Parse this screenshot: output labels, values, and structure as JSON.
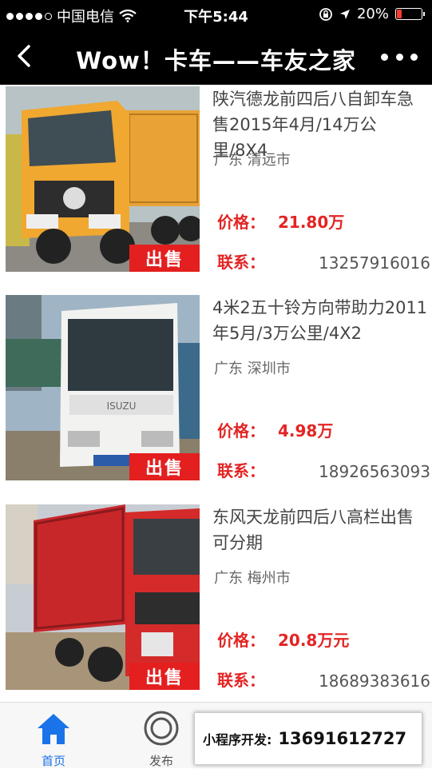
{
  "status_bar": {
    "carrier": "中国电信",
    "time": "下午5:44",
    "battery": "20%",
    "battery_level": 0.2
  },
  "nav": {
    "title": "Wow！卡车——车友之家"
  },
  "listings": [
    {
      "title": "陕汽德龙前四后八自卸车急售2015年4月/14万公里/8X4",
      "location": "广东 清远市",
      "price_label": "价格：",
      "price": "21.80万",
      "contact_label": "联系：",
      "phone": "13257916016",
      "tag": "出售"
    },
    {
      "title": "4米2五十铃方向带助力2011年5月/3万公里/4X2",
      "location": "广东 深圳市",
      "price_label": "价格：",
      "price": "4.98万",
      "contact_label": "联系：",
      "phone": "18926563093",
      "tag": "出售"
    },
    {
      "title": "东风天龙前四后八高栏出售可分期",
      "location": "广东 梅州市",
      "price_label": "价格：",
      "price": "20.8万元",
      "contact_label": "联系：",
      "phone": "18689383616",
      "tag": "出售"
    }
  ],
  "tabs": [
    {
      "label": "首页",
      "icon": "home-icon",
      "active": true
    },
    {
      "label": "发布",
      "icon": "publish-icon",
      "active": false
    }
  ],
  "promo": {
    "label": "小程序开发:",
    "phone": "13691612727"
  },
  "colors": {
    "accent_red": "#e42424",
    "tab_active_blue": "#1a73e8"
  }
}
